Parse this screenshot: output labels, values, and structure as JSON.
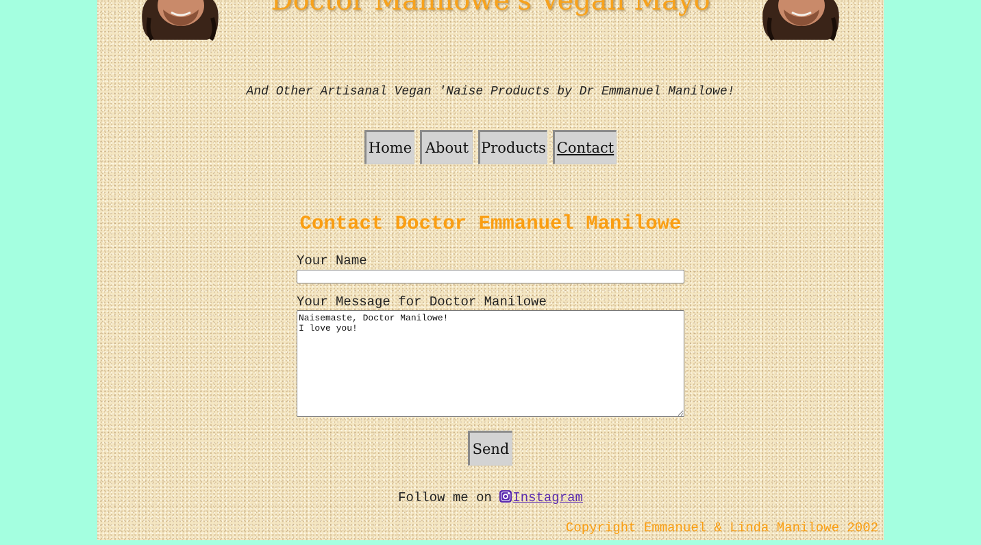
{
  "header": {
    "site_title": "Doctor Manilowe's Vegan Mayo",
    "tagline": "And Other Artisanal Vegan 'Naise Products by Dr Emmanuel Manilowe!"
  },
  "nav": {
    "items": [
      {
        "label": "Home"
      },
      {
        "label": "About"
      },
      {
        "label": "Products"
      },
      {
        "label": "Contact",
        "active": true
      }
    ]
  },
  "contact": {
    "title": "Contact Doctor Emmanuel Manilowe",
    "name_label": "Your Name",
    "name_value": "",
    "message_label": "Your Message for Doctor Manilowe",
    "message_value": "Naisemaste, Doctor Manilowe!\nI love you!",
    "send_label": "Send"
  },
  "footer": {
    "follow_text": "Follow me on ",
    "instagram_icon": "instagram-icon",
    "instagram_label": "Instagram",
    "copyright": "Copyright Emmanuel & Linda Manilowe 2002"
  },
  "colors": {
    "outer_background": "#a4ffe0",
    "accent_orange": "#fa9e12",
    "link_purple": "#5a2bb0",
    "button_gray": "#d3d3d3"
  }
}
